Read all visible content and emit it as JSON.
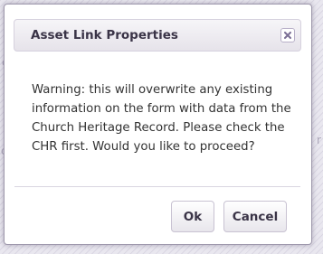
{
  "dialog": {
    "title": "Asset Link Properties",
    "close_icon": "close-icon",
    "message": "Warning: this will overwrite any existing information on the form with data from the Church Heritage Record. Please check the CHR first. Would you like to proceed?",
    "buttons": {
      "ok_label": "Ok",
      "cancel_label": "Cancel"
    }
  },
  "background": {
    "fragments": [
      "c",
      "e",
      "c",
      "r"
    ]
  },
  "colors": {
    "close_icon": "#7b6f95",
    "text": "#333333",
    "title": "#3a3447"
  }
}
